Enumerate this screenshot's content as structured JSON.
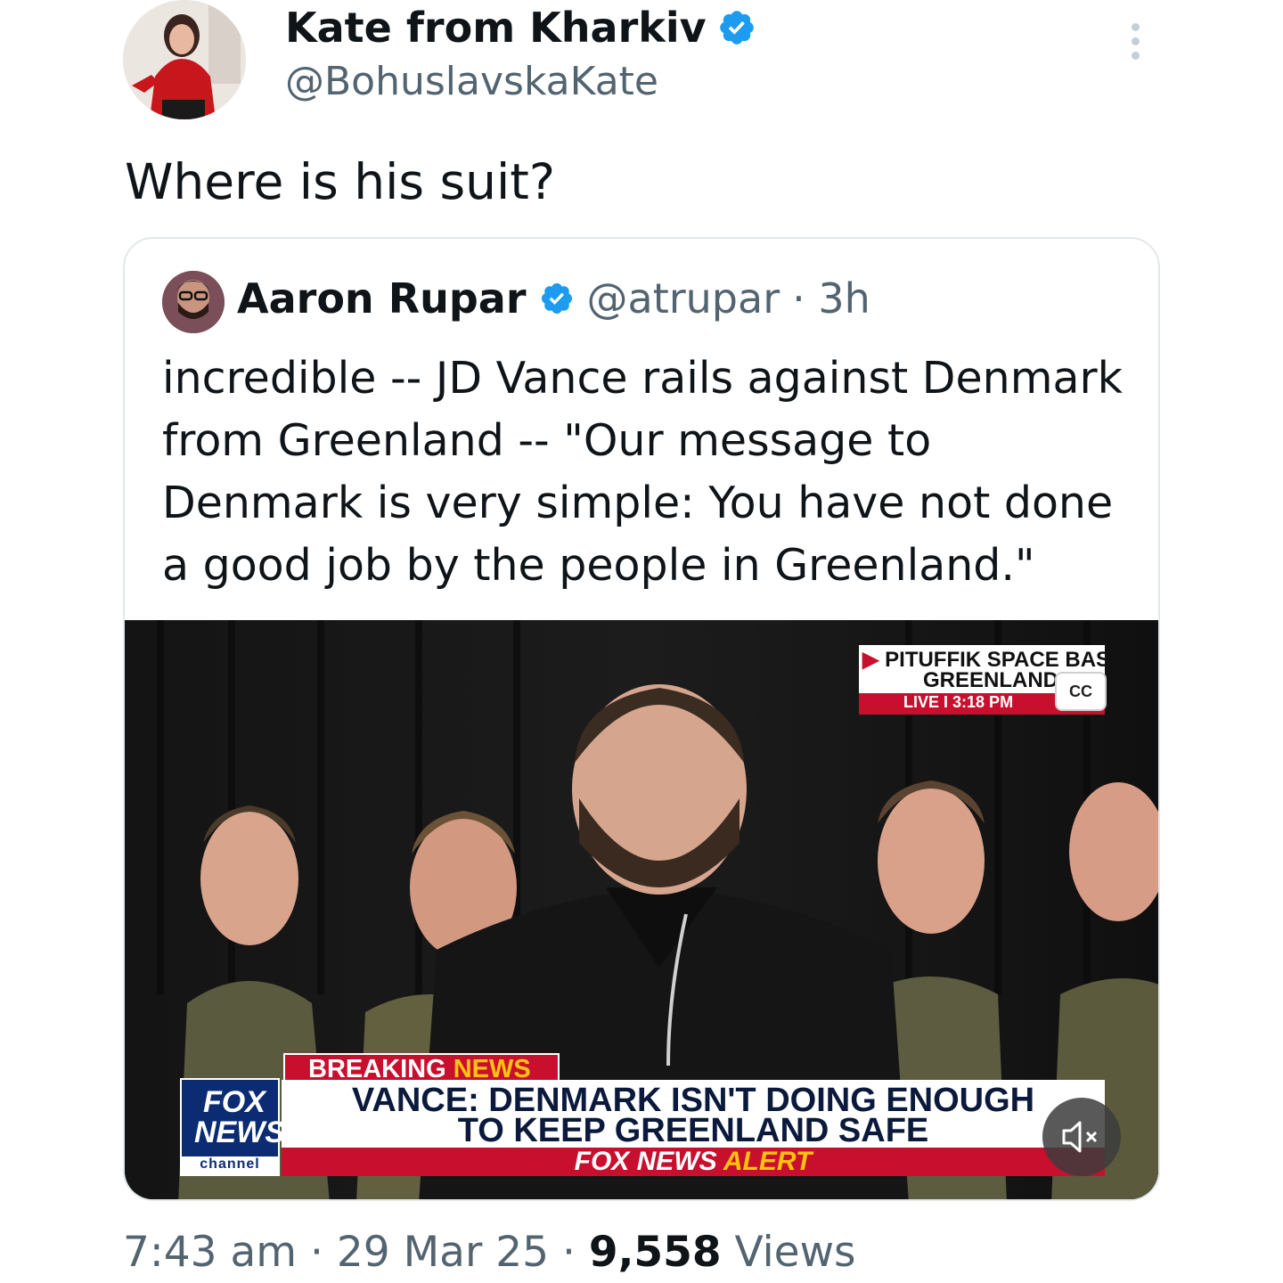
{
  "tweet": {
    "author": {
      "name": "Kate from Kharkiv",
      "handle": "@BohuslavskaKate",
      "verified": true,
      "avatar_icon": "profile-photo-woman-red-blouse"
    },
    "text": "Where is his suit?",
    "timestamp": "7:43 am · 29 Mar 25 · ",
    "views_count": "9,558",
    "views_label": "Views",
    "more_icon": "vertical-ellipsis-icon"
  },
  "quoted_tweet": {
    "author": {
      "name": "Aaron Rupar",
      "handle": "@atrupar",
      "age": "· 3h",
      "verified": true,
      "avatar_icon": "profile-photo-man-glasses"
    },
    "text": "incredible -- JD Vance rails against Denmark from Greenland -- \"Our message to Denmark is very simple: You have not done a good job by the people in Greenland.\"",
    "video": {
      "location_line1": "PITUFFIK SPACE BASE",
      "location_line2": "GREENLAND",
      "live_label": "LIVE",
      "live_time": "I  3:18 PM",
      "cc_label": "CC",
      "breaking_word1": "BREAKING",
      "breaking_word2": "NEWS",
      "headline_line1": "VANCE: DENMARK ISN'T DOING ENOUGH",
      "headline_line2": "TO KEEP GREENLAND SAFE",
      "alert_word1": "FOX NEWS",
      "alert_word2": "ALERT",
      "logo_line1": "FOX",
      "logo_line2": "NEWS",
      "logo_line3": "channel",
      "mute_icon": "speaker-muted-icon",
      "colors": {
        "red": "#c8102e",
        "gold": "#ffc20e",
        "navy": "#0b2c73"
      }
    }
  },
  "colors": {
    "verified_blue": "#1d9bf0",
    "secondary_text": "#536471",
    "primary_text": "#0f1419"
  }
}
